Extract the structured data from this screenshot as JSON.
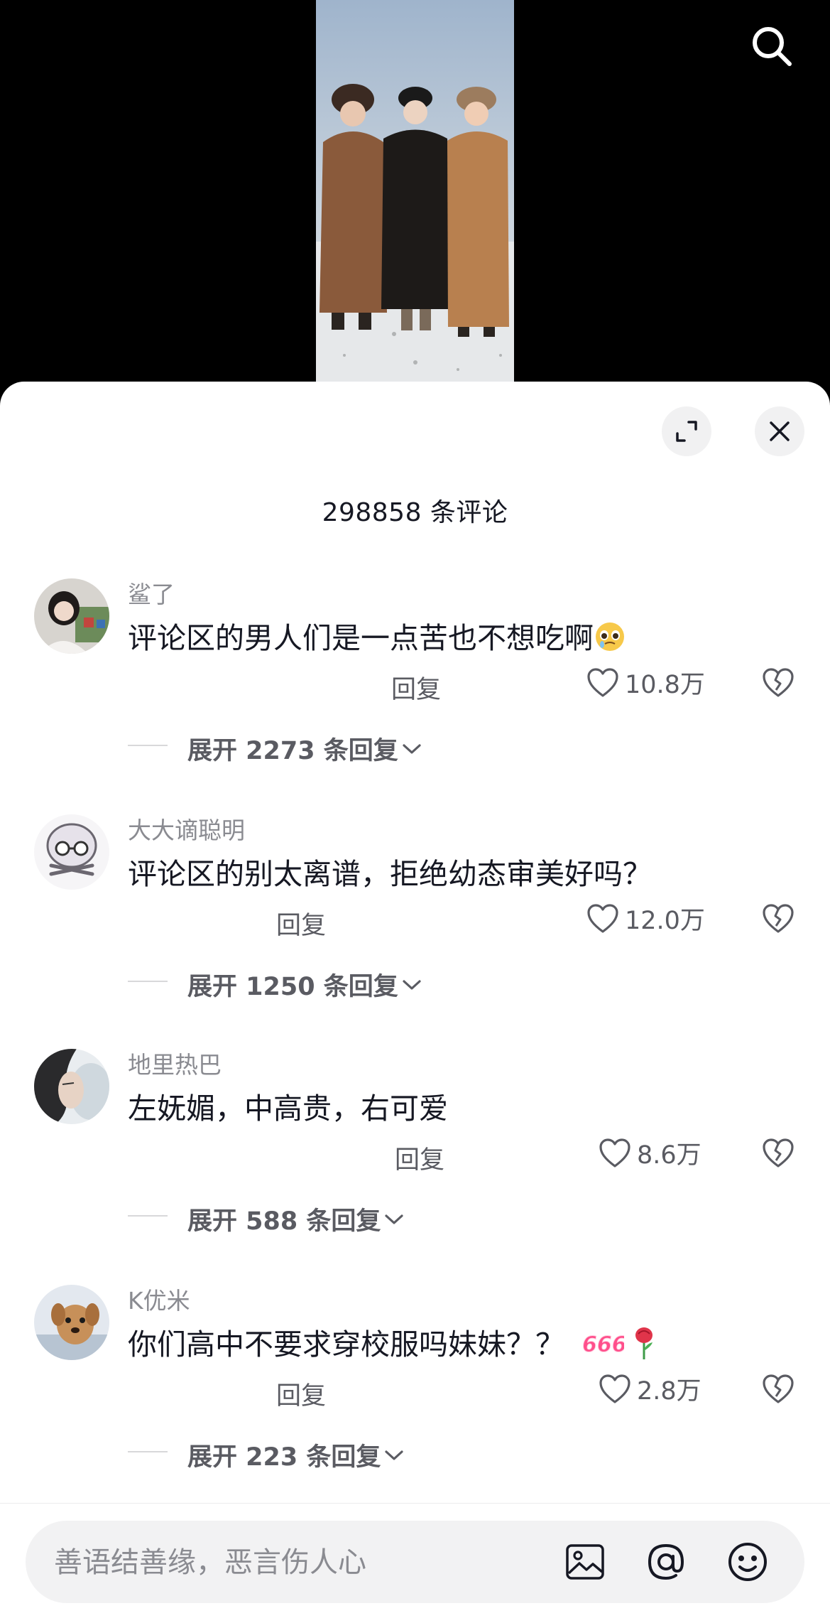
{
  "header": {
    "comment_count_label": "298858 条评论"
  },
  "comments": [
    {
      "username": "鲨了",
      "text": "评论区的男人们是一点苦也不想吃啊",
      "emoji": "pleading-face-emoji",
      "reply_label": "回复",
      "likes": "10.8万",
      "expand_label": "展开 2273 条回复"
    },
    {
      "username": "大大谪聪明",
      "text": "评论区的别太离谱，拒绝幼态审美好吗？",
      "reply_label": "回复",
      "likes": "12.0万",
      "expand_label": "展开 1250 条回复"
    },
    {
      "username": "地里热巴",
      "text": "左妩媚，中高贵，右可爱",
      "reply_label": "回复",
      "likes": "8.6万",
      "expand_label": "展开 588 条回复"
    },
    {
      "username": "K优米",
      "text": "你们高中不要求穿校服吗妹妹？？",
      "emoji": "666-sticker rose-emoji",
      "reply_label": "回复",
      "likes": "2.8万",
      "expand_label": "展开 223 条回复"
    }
  ],
  "input": {
    "placeholder": "善语结善缘，恶言伤人心"
  },
  "icons": {
    "search": "search-icon",
    "expand": "expand-icon",
    "close": "close-icon",
    "like": "heart-icon",
    "dislike": "broken-heart-icon",
    "image": "image-icon",
    "mention": "at-icon",
    "emoji": "smiley-icon"
  },
  "colors": {
    "text_primary": "#161823",
    "text_secondary": "#8a8b91",
    "sheet_bg": "#ffffff",
    "video_bg": "#000000"
  }
}
